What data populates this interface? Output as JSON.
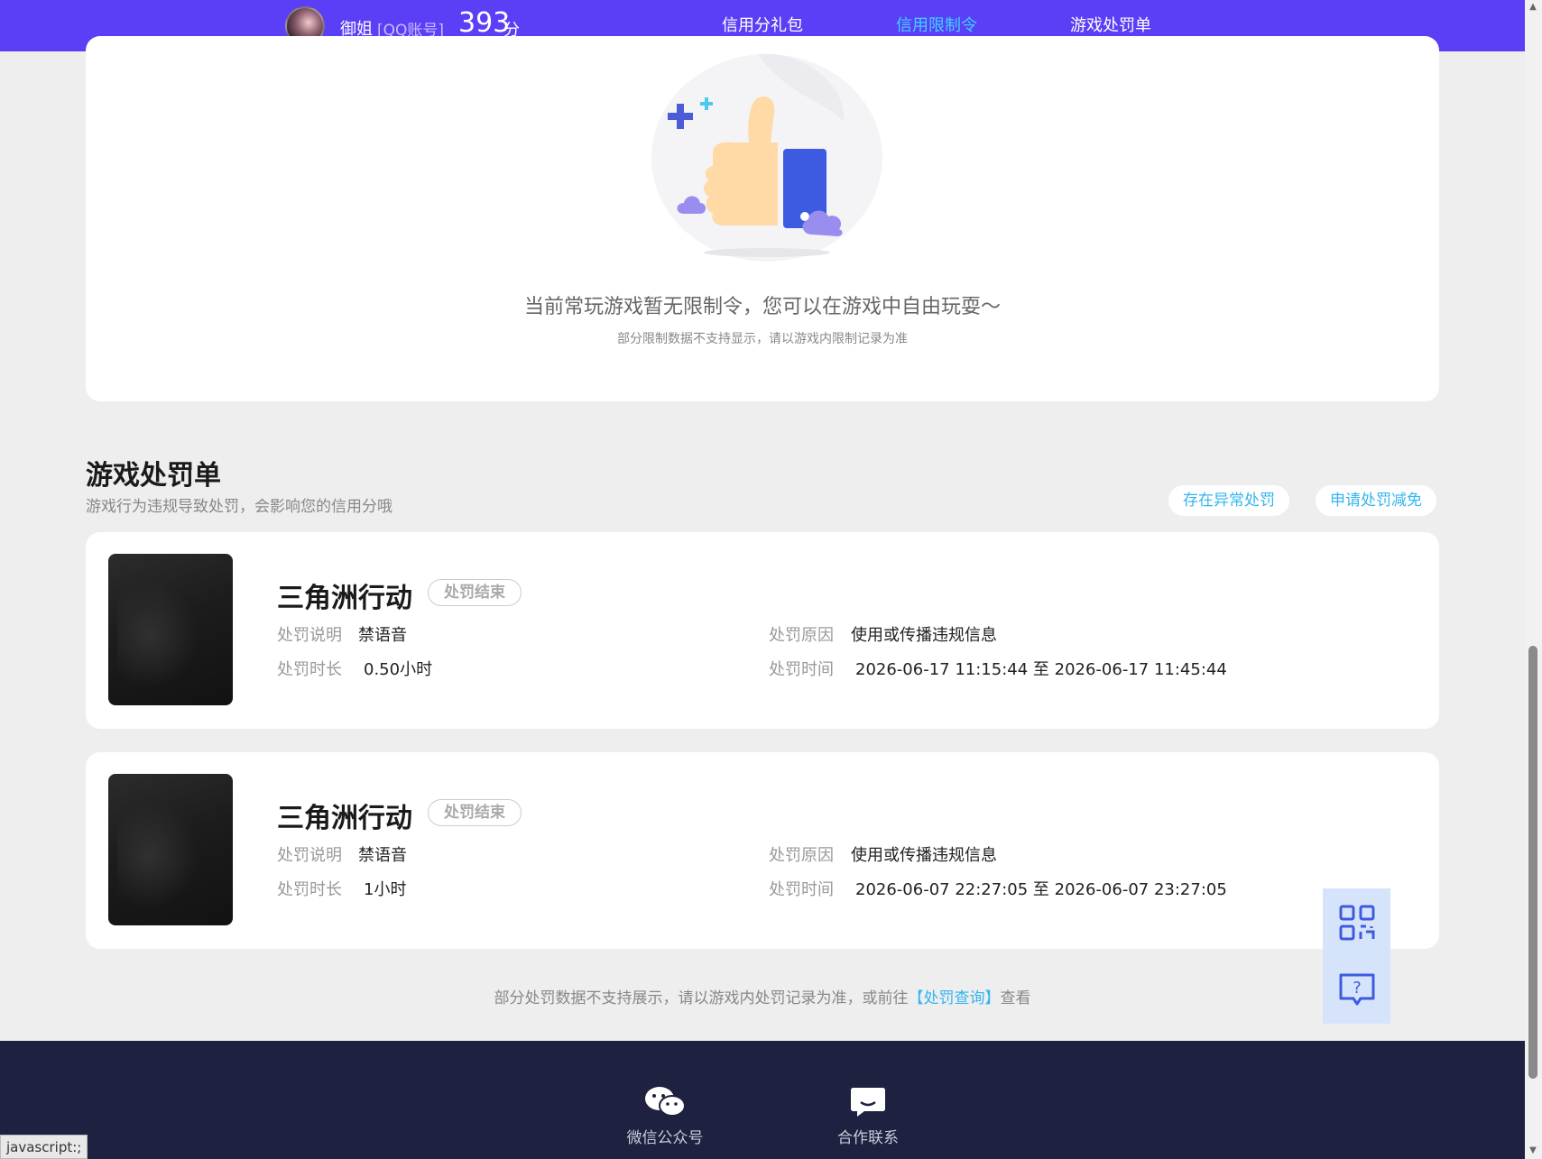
{
  "header": {
    "username": "御姐",
    "account_type": "[QQ账号]",
    "score": "393",
    "score_unit": "分",
    "nav": [
      {
        "label": "信用分礼包"
      },
      {
        "label": "信用限制令"
      },
      {
        "label": "游戏处罚单"
      }
    ]
  },
  "restriction": {
    "empty_title": "当前常玩游戏暂无限制令，您可以在游戏中自由玩耍～",
    "empty_sub": "部分限制数据不支持显示，请以游戏内限制记录为准"
  },
  "punishment": {
    "title": "游戏处罚单",
    "desc": "游戏行为违规导致处罚，会影响您的信用分哦",
    "btn_abnormal": "存在异常处罚",
    "btn_reduce": "申请处罚减免",
    "labels": {
      "desc": "处罚说明",
      "duration": "处罚时长",
      "reason": "处罚原因",
      "time": "处罚时间"
    },
    "items": [
      {
        "game": "三角洲行动",
        "status": "处罚结束",
        "desc": "禁语音",
        "duration": "0.50小时",
        "reason": "使用或传播违规信息",
        "time": "2026-06-17 11:15:44 至 2026-06-17 11:45:44"
      },
      {
        "game": "三角洲行动",
        "status": "处罚结束",
        "desc": "禁语音",
        "duration": "1小时",
        "reason": "使用或传播违规信息",
        "time": "2026-06-07 22:27:05 至 2026-06-07 23:27:05"
      }
    ],
    "footer_note_pre": "部分处罚数据不支持展示，请以游戏内处罚记录为准，或前往",
    "footer_note_link": "【处罚查询】",
    "footer_note_post": "查看"
  },
  "footer": {
    "wechat": "微信公众号",
    "contact": "合作联系"
  },
  "statusbar": "javascript:;",
  "icons": {
    "qr": "qr-code-icon",
    "help": "help-chat-icon",
    "wechat": "wechat-icon",
    "contact": "chat-bubble-icon"
  },
  "colors": {
    "header_bg": "#5b3ff6",
    "active_nav": "#3fd3ff",
    "link": "#33b6ee",
    "footer_bg": "#1f2140"
  }
}
